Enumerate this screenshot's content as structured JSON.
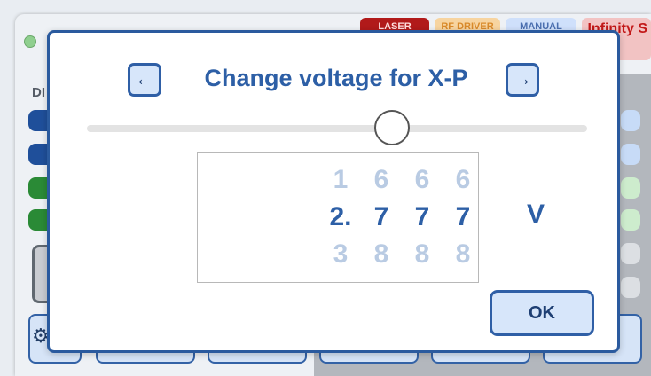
{
  "background": {
    "tags": {
      "laser": "LASER",
      "rf_driver": "RF DRIVER",
      "manual": "MANUAL",
      "infinity": "Infinity S"
    },
    "section_label": "DI"
  },
  "dialog": {
    "title": "Change voltage for X-P",
    "prev_icon": "←",
    "next_icon": "→",
    "ok_label": "OK",
    "unit": "V",
    "slider_value": 0.61,
    "digits": [
      {
        "above": "1",
        "current": "2.",
        "below": "3"
      },
      {
        "above": "6",
        "current": "7",
        "below": "8"
      },
      {
        "above": "6",
        "current": "7",
        "below": "8"
      },
      {
        "above": "6",
        "current": "7",
        "below": "8"
      }
    ]
  },
  "colors": {
    "accent": "#2d5fa6",
    "button_fill": "#d7e6fa",
    "digit_faded": "#b9cbe3"
  }
}
